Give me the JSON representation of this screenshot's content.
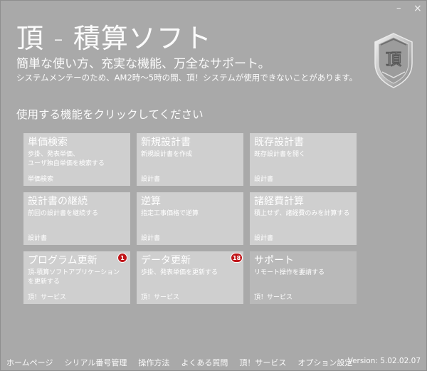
{
  "window": {
    "minimize_label": "–",
    "close_label": "×"
  },
  "header": {
    "title": "頂 - 積算ソフト",
    "tagline": "簡単な使い方、充実な機能、万全なサポート。",
    "notice": "システムメンテーのため、AM2時～5時の間、頂！システムが使用できないことがあります。",
    "logo_text": "頂"
  },
  "main": {
    "heading": "使用する機能をクリックしてください",
    "tiles": [
      {
        "title": "単価検索",
        "desc": "歩掛、発表単価、\nユーザ独自単価を検索する",
        "footer": "単価検索",
        "badge": ""
      },
      {
        "title": "新規設計書",
        "desc": "新規設計書を作成",
        "footer": "設計書",
        "badge": ""
      },
      {
        "title": "既存設計書",
        "desc": "既存設計書を開く",
        "footer": "設計書",
        "badge": ""
      },
      {
        "title": "設計書の継続",
        "desc": "前回の設計書を継続する",
        "footer": "設計書",
        "badge": ""
      },
      {
        "title": "逆算",
        "desc": "指定工事価格で逆算",
        "footer": "設計書",
        "badge": ""
      },
      {
        "title": "諸経費計算",
        "desc": "積上せず、諸経費のみを計算する",
        "footer": "設計書",
        "badge": ""
      },
      {
        "title": "プログラム更新",
        "desc": "頂-積算ソフトアプリケーション\nを更新する",
        "footer": "頂！サービス",
        "badge": "1"
      },
      {
        "title": "データ更新",
        "desc": "歩掛、発表単価を更新する",
        "footer": "頂！サービス",
        "badge": "18"
      },
      {
        "title": "サポート",
        "desc": "リモート操作を要請する",
        "footer": "頂！サービス",
        "badge": ""
      }
    ]
  },
  "footer": {
    "links": [
      "ホームページ",
      "シリアル番号管理",
      "操作方法",
      "よくある質問",
      "頂！サービス",
      "オプション設定"
    ],
    "version": "Version: 5.02.02.07"
  },
  "colors": {
    "background": "#a9a9a9",
    "tile": "#cfcfcf",
    "tile_dark": "#b9b9b9",
    "badge": "#c0161a",
    "text": "#ffffff"
  }
}
